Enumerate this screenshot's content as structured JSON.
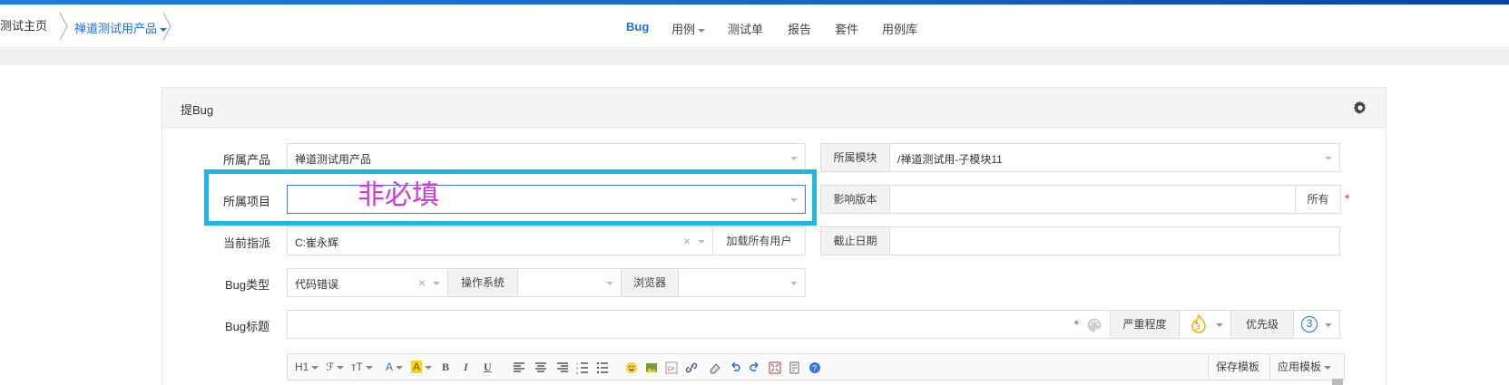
{
  "breadcrumb": {
    "home": "测试主页",
    "product": "禅道测试用产品"
  },
  "nav": {
    "bug": "Bug",
    "testcase": "用例",
    "testtask": "测试单",
    "report": "报告",
    "suite": "套件",
    "caselib": "用例库"
  },
  "panel": {
    "title": "提Bug"
  },
  "form": {
    "product_label": "所属产品",
    "product_value": "禅道测试用产品",
    "module_label": "所属模块",
    "module_value": "/禅道测试用-子模块11",
    "project_label": "所属项目",
    "project_value": "",
    "build_label": "影响版本",
    "build_value": "",
    "build_all": "所有",
    "assign_label": "当前指派",
    "assign_value": "C:崔永辉",
    "load_users": "加载所有用户",
    "deadline_label": "截止日期",
    "deadline_value": "",
    "type_label": "Bug类型",
    "type_value": "代码错误",
    "os_label": "操作系统",
    "browser_label": "浏览器",
    "title_label": "Bug标题",
    "severity_label": "严重程度",
    "severity_value": "3",
    "priority_label": "优先级",
    "priority_value": "3",
    "required_mark": "*",
    "clear_mark": "×"
  },
  "annotation": {
    "text": "非必填"
  },
  "editor": {
    "h1": "H1",
    "font": "ℱ",
    "size": "тT",
    "color": "A",
    "bgcolor": "A",
    "bold": "B",
    "italic": "I",
    "underline": "U",
    "save_template": "保存模板",
    "apply_template": "应用模板"
  },
  "colors": {
    "accent": "#1e6fd9",
    "highlight": "#1cb7e6",
    "annotation": "#d837d8",
    "required": "#e53935"
  }
}
